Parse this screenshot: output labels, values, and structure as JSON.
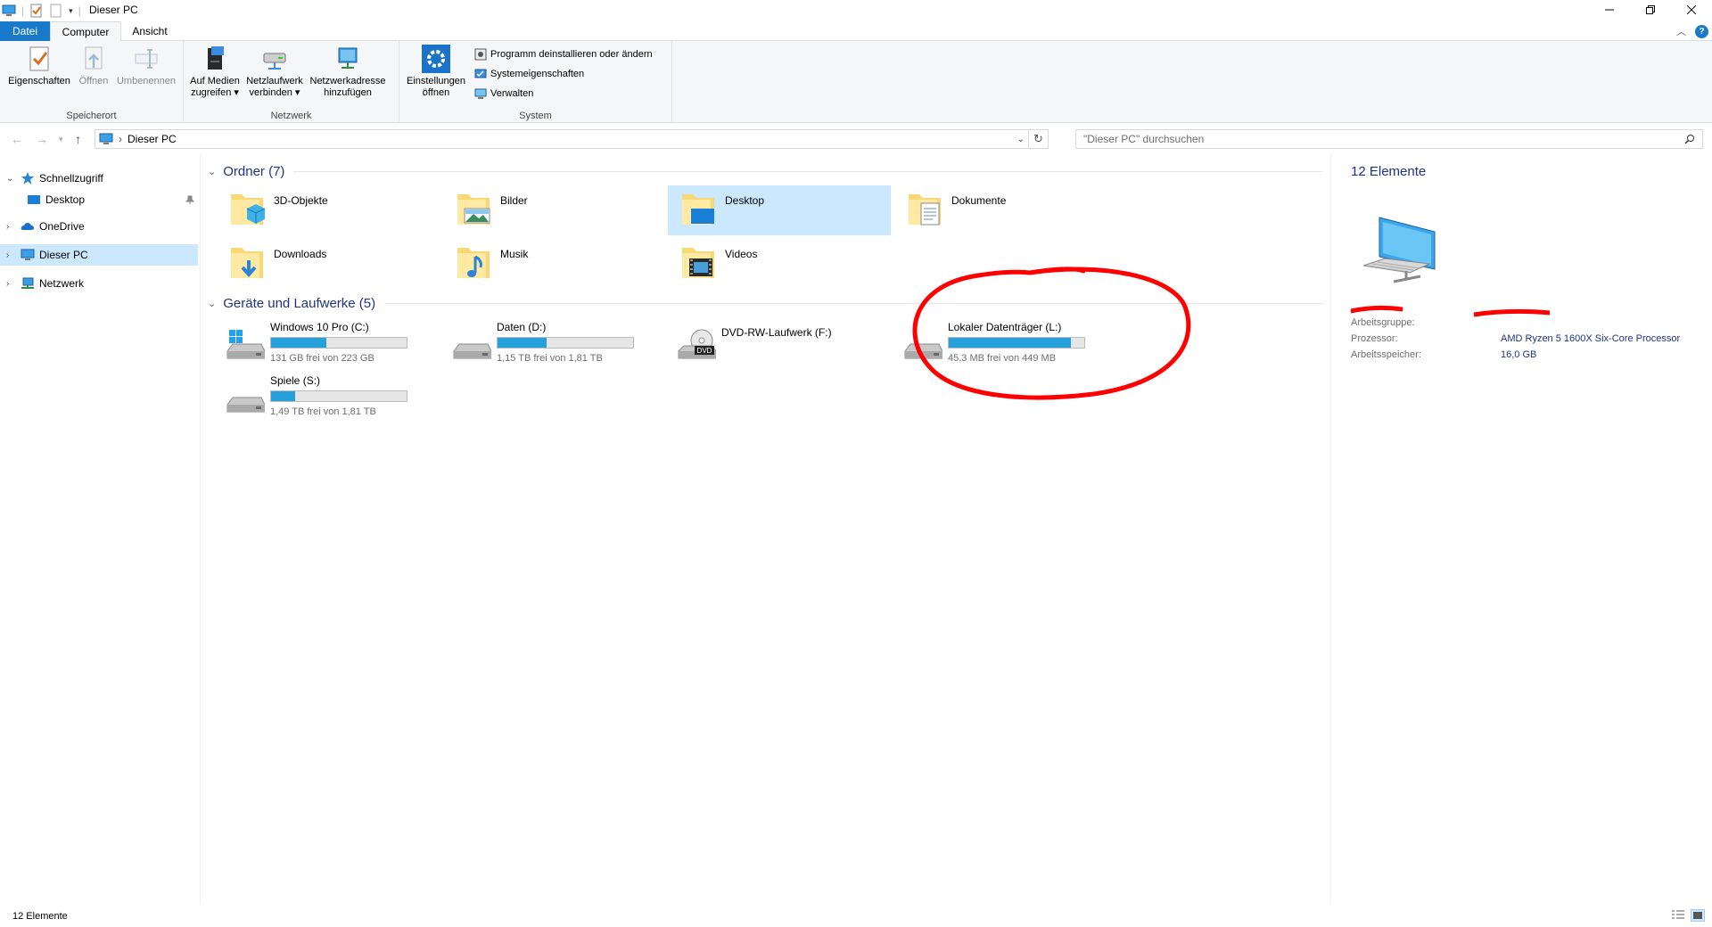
{
  "window": {
    "title": "Dieser PC"
  },
  "ribbon_tabs": {
    "datei": "Datei",
    "computer": "Computer",
    "ansicht": "Ansicht"
  },
  "ribbon": {
    "speicherort": {
      "label": "Speicherort",
      "eigenschaften": "Eigenschaften",
      "oeffnen": "Öffnen",
      "umbenennen": "Umbenennen"
    },
    "netzwerk": {
      "label": "Netzwerk",
      "medien_1": "Auf Medien",
      "medien_2": "zugreifen",
      "netzlaufwerk_1": "Netzlaufwerk",
      "netzlaufwerk_2": "verbinden",
      "adresse_1": "Netzwerkadresse",
      "adresse_2": "hinzufügen"
    },
    "system": {
      "label": "System",
      "einstellungen_1": "Einstellungen",
      "einstellungen_2": "öffnen",
      "deinstallieren": "Programm deinstallieren oder ändern",
      "systemeigenschaften": "Systemeigenschaften",
      "verwalten": "Verwalten"
    }
  },
  "address": {
    "path": "Dieser PC",
    "search_placeholder": "\"Dieser PC\" durchsuchen"
  },
  "nav": {
    "schnellzugriff": "Schnellzugriff",
    "desktop": "Desktop",
    "onedrive": "OneDrive",
    "dieser_pc": "Dieser PC",
    "netzwerk": "Netzwerk"
  },
  "sections": {
    "ordner": "Ordner (7)",
    "geraete": "Geräte und Laufwerke (5)"
  },
  "folders": [
    "3D-Objekte",
    "Bilder",
    "Desktop",
    "Dokumente",
    "Downloads",
    "Musik",
    "Videos"
  ],
  "drives": [
    {
      "name": "Windows 10 Pro (C:)",
      "free": "131 GB frei von 223 GB",
      "used_fraction": 0.41
    },
    {
      "name": "Daten (D:)",
      "free": "1,15 TB frei von 1,81 TB",
      "used_fraction": 0.36
    },
    {
      "name": "DVD-RW-Laufwerk (F:)",
      "free": "",
      "used_fraction": null
    },
    {
      "name": "Lokaler Datenträger (L:)",
      "free": "45,3 MB frei von 449 MB",
      "used_fraction": 0.9
    },
    {
      "name": "Spiele (S:)",
      "free": "1,49 TB frei von 1,81 TB",
      "used_fraction": 0.18
    }
  ],
  "details": {
    "count": "12 Elemente",
    "arbeitsgruppe_label": "Arbeitsgruppe:",
    "prozessor_label": "Prozessor:",
    "prozessor_value": "AMD Ryzen 5 1600X Six-Core Processor",
    "speicher_label": "Arbeitsspeicher:",
    "speicher_value": "16,0 GB"
  },
  "status": {
    "count": "12 Elemente"
  },
  "colors": {
    "accent": "#1979ca",
    "bar_fill": "#26a0da",
    "selection": "#cce8ff",
    "annotation": "#ff0000"
  }
}
